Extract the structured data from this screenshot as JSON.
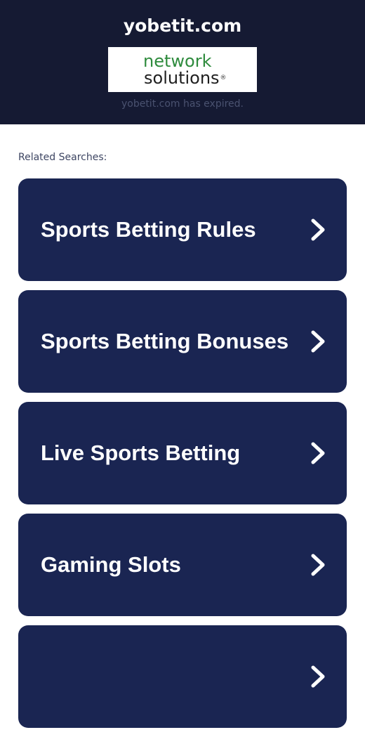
{
  "header": {
    "site_title": "yobetit.com",
    "logo": {
      "line1": "network",
      "line2": "solutions",
      "registered_mark": "®",
      "brand_green": "#2e8b3d"
    },
    "expired_message": "yobetit.com has expired."
  },
  "related": {
    "label": "Related Searches:",
    "items": [
      {
        "label": "Sports Betting Rules",
        "icon": "chevron-right-icon"
      },
      {
        "label": "Sports Betting Bonuses",
        "icon": "chevron-right-icon"
      },
      {
        "label": "Live Sports Betting",
        "icon": "chevron-right-icon"
      },
      {
        "label": "Gaming Slots",
        "icon": "chevron-right-icon"
      },
      {
        "label": "",
        "icon": "chevron-right-icon"
      }
    ]
  },
  "colors": {
    "header_bg": "#151a33",
    "card_bg": "#1a2552",
    "text_white": "#ffffff",
    "muted_text": "#4a5270"
  }
}
